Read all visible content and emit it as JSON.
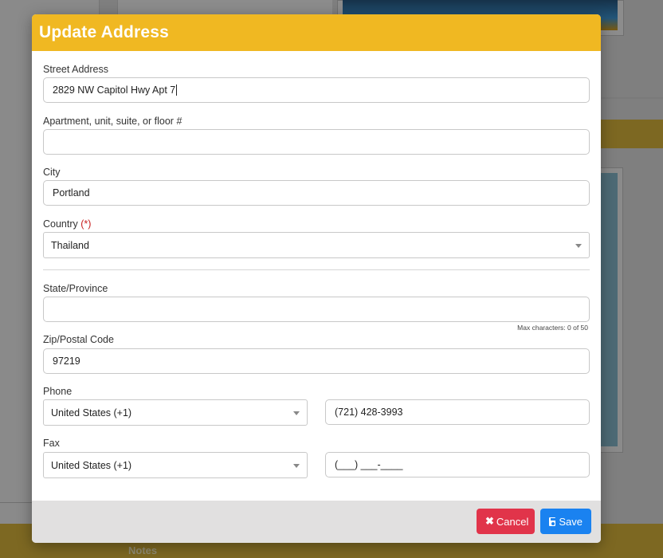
{
  "modal": {
    "title": "Update Address"
  },
  "form": {
    "street": {
      "label": "Street Address",
      "value": "2829 NW Capitol Hwy Apt 7"
    },
    "apartment": {
      "label": "Apartment, unit, suite, or floor #",
      "value": ""
    },
    "city": {
      "label": "City",
      "value": "Portland"
    },
    "country": {
      "label": "Country",
      "required_marker": "(*)",
      "value": "Thailand"
    },
    "state": {
      "label": "State/Province",
      "value": "",
      "hint": "Max characters: 0 of 50"
    },
    "zip": {
      "label": "Zip/Postal Code",
      "value": "97219"
    },
    "phone": {
      "label": "Phone",
      "country_code": "United States (+1)",
      "value": "(721) 428-3993"
    },
    "fax": {
      "label": "Fax",
      "country_code": "United States (+1)",
      "value": "(___) ___-____"
    }
  },
  "footer": {
    "cancel_label": "Cancel",
    "save_label": "Save",
    "cancel_color": "#e1344a",
    "save_color": "#1a82f0"
  },
  "background": {
    "notes_label": "Notes",
    "accent_color": "#f0b822"
  }
}
